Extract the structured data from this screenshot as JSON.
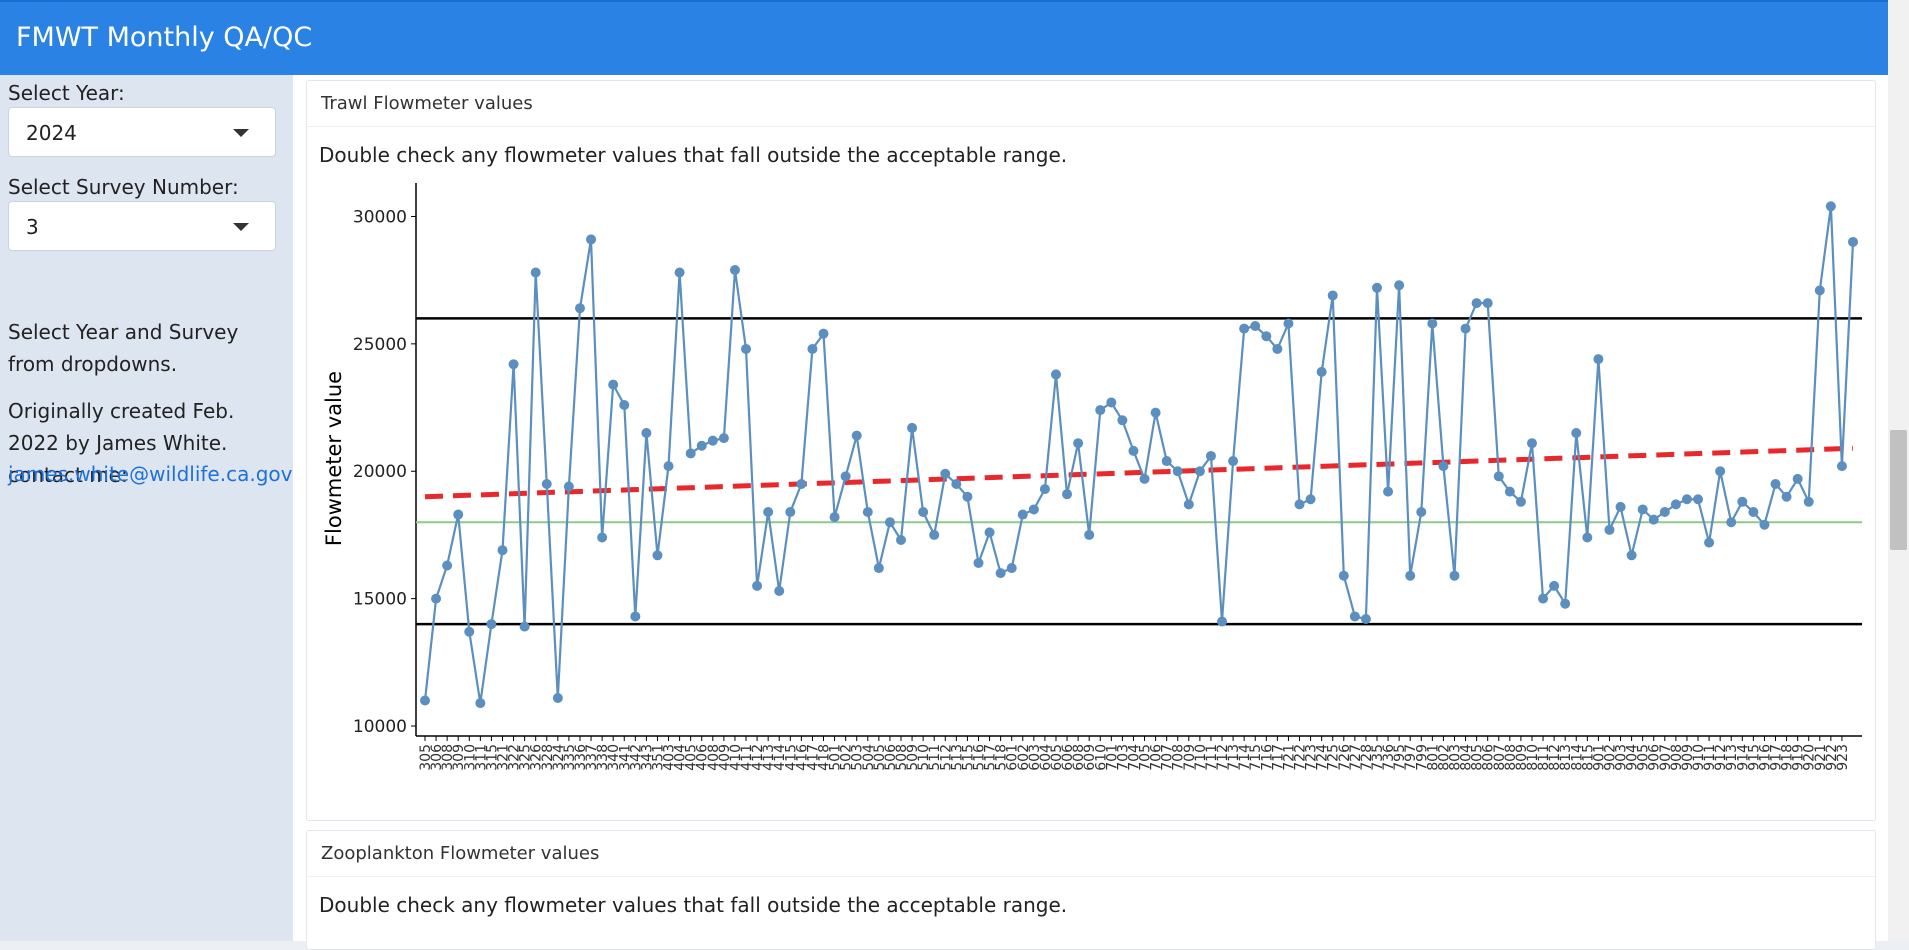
{
  "app": {
    "title": "FMWT Monthly QA/QC"
  },
  "sidebar": {
    "year_label": "Select Year:",
    "year_value": "2024",
    "survey_label": "Select Survey Number:",
    "survey_value": "3",
    "instructions": "Select Year and Survey from dropdowns.",
    "credit": "Originally created Feb. 2022 by James White. contact me:",
    "email": "james.white@wildlife.ca.gov"
  },
  "panels": [
    {
      "title": "Trawl Flowmeter values",
      "description": "Double check any flowmeter values that fall outside the acceptable range."
    },
    {
      "title": "Zooplankton Flowmeter values",
      "description": "Double check any flowmeter values that fall outside the acceptable range."
    }
  ],
  "chart_data": {
    "type": "line",
    "ylabel": "Flowmeter value",
    "xlabel": "",
    "ylim": [
      10000,
      31000
    ],
    "yticks": [
      10000,
      15000,
      20000,
      25000,
      30000
    ],
    "reference_lines": {
      "upper": 26000,
      "lower": 14000,
      "target": 18000
    },
    "trend_line": {
      "start": 19000,
      "end": 20900
    },
    "colors": {
      "series": "#5b8fbf",
      "trend": "#e8282b",
      "limits": "#000000",
      "target": "#8fc98a"
    },
    "x_tick_labels": [
      "305",
      "306",
      "308",
      "309",
      "310",
      "311",
      "315",
      "321",
      "322",
      "325",
      "326",
      "328",
      "324",
      "335",
      "336",
      "337",
      "338",
      "340",
      "341",
      "342",
      "343",
      "351",
      "403",
      "404",
      "405",
      "406",
      "408",
      "409",
      "410",
      "411",
      "412",
      "413",
      "414",
      "415",
      "416",
      "417",
      "418",
      "501",
      "502",
      "503",
      "504",
      "505",
      "506",
      "508",
      "509",
      "510",
      "511",
      "512",
      "513",
      "515",
      "516",
      "517",
      "518",
      "601",
      "602",
      "603",
      "604",
      "605",
      "606",
      "608",
      "609",
      "610",
      "701",
      "703",
      "704",
      "705",
      "706",
      "707",
      "708",
      "709",
      "710",
      "711",
      "712",
      "713",
      "714",
      "715",
      "716",
      "717",
      "721",
      "722",
      "723",
      "724",
      "725",
      "726",
      "727",
      "728",
      "735",
      "736",
      "795",
      "797",
      "799",
      "801",
      "802",
      "803",
      "804",
      "805",
      "806",
      "807",
      "808",
      "809",
      "810",
      "811",
      "812",
      "813",
      "814",
      "815",
      "901",
      "902",
      "903",
      "904",
      "905",
      "906",
      "907",
      "908",
      "909",
      "910",
      "911",
      "912",
      "913",
      "914",
      "915",
      "916",
      "917",
      "918",
      "919",
      "920",
      "921",
      "922",
      "923"
    ],
    "values": [
      11000,
      15000,
      16300,
      18300,
      13700,
      10900,
      14000,
      16900,
      24200,
      13900,
      27800,
      19500,
      11100,
      19400,
      26400,
      29100,
      17400,
      23400,
      22600,
      14300,
      21500,
      16700,
      20200,
      27800,
      20700,
      21000,
      21200,
      21300,
      27900,
      24800,
      15500,
      18400,
      15300,
      18400,
      19500,
      24800,
      25400,
      18200,
      19800,
      21400,
      18400,
      16200,
      18000,
      17300,
      21700,
      18400,
      17500,
      19900,
      19500,
      19000,
      16400,
      17600,
      16000,
      16200,
      18300,
      18500,
      19300,
      23800,
      19100,
      21100,
      17500,
      22400,
      22700,
      22000,
      20800,
      19700,
      22300,
      20400,
      20000,
      18700,
      20000,
      20600,
      14100,
      20400,
      25600,
      25700,
      25300,
      24800,
      25800,
      18700,
      18900,
      23900,
      26900,
      15900,
      14300,
      14200,
      27200,
      19200,
      27300,
      15900,
      18400,
      25800,
      20200,
      15900,
      25600,
      26600,
      26600,
      19800,
      19200,
      18800,
      21100,
      15000,
      15500,
      14800,
      21500,
      17400,
      24400,
      17700,
      18600,
      16700,
      18500,
      18100,
      18400,
      18700,
      18900,
      18900,
      17200,
      20000,
      18000,
      18800,
      18400,
      17900,
      19500,
      19000,
      19700,
      18800,
      27100,
      30400,
      20200,
      29000
    ]
  }
}
